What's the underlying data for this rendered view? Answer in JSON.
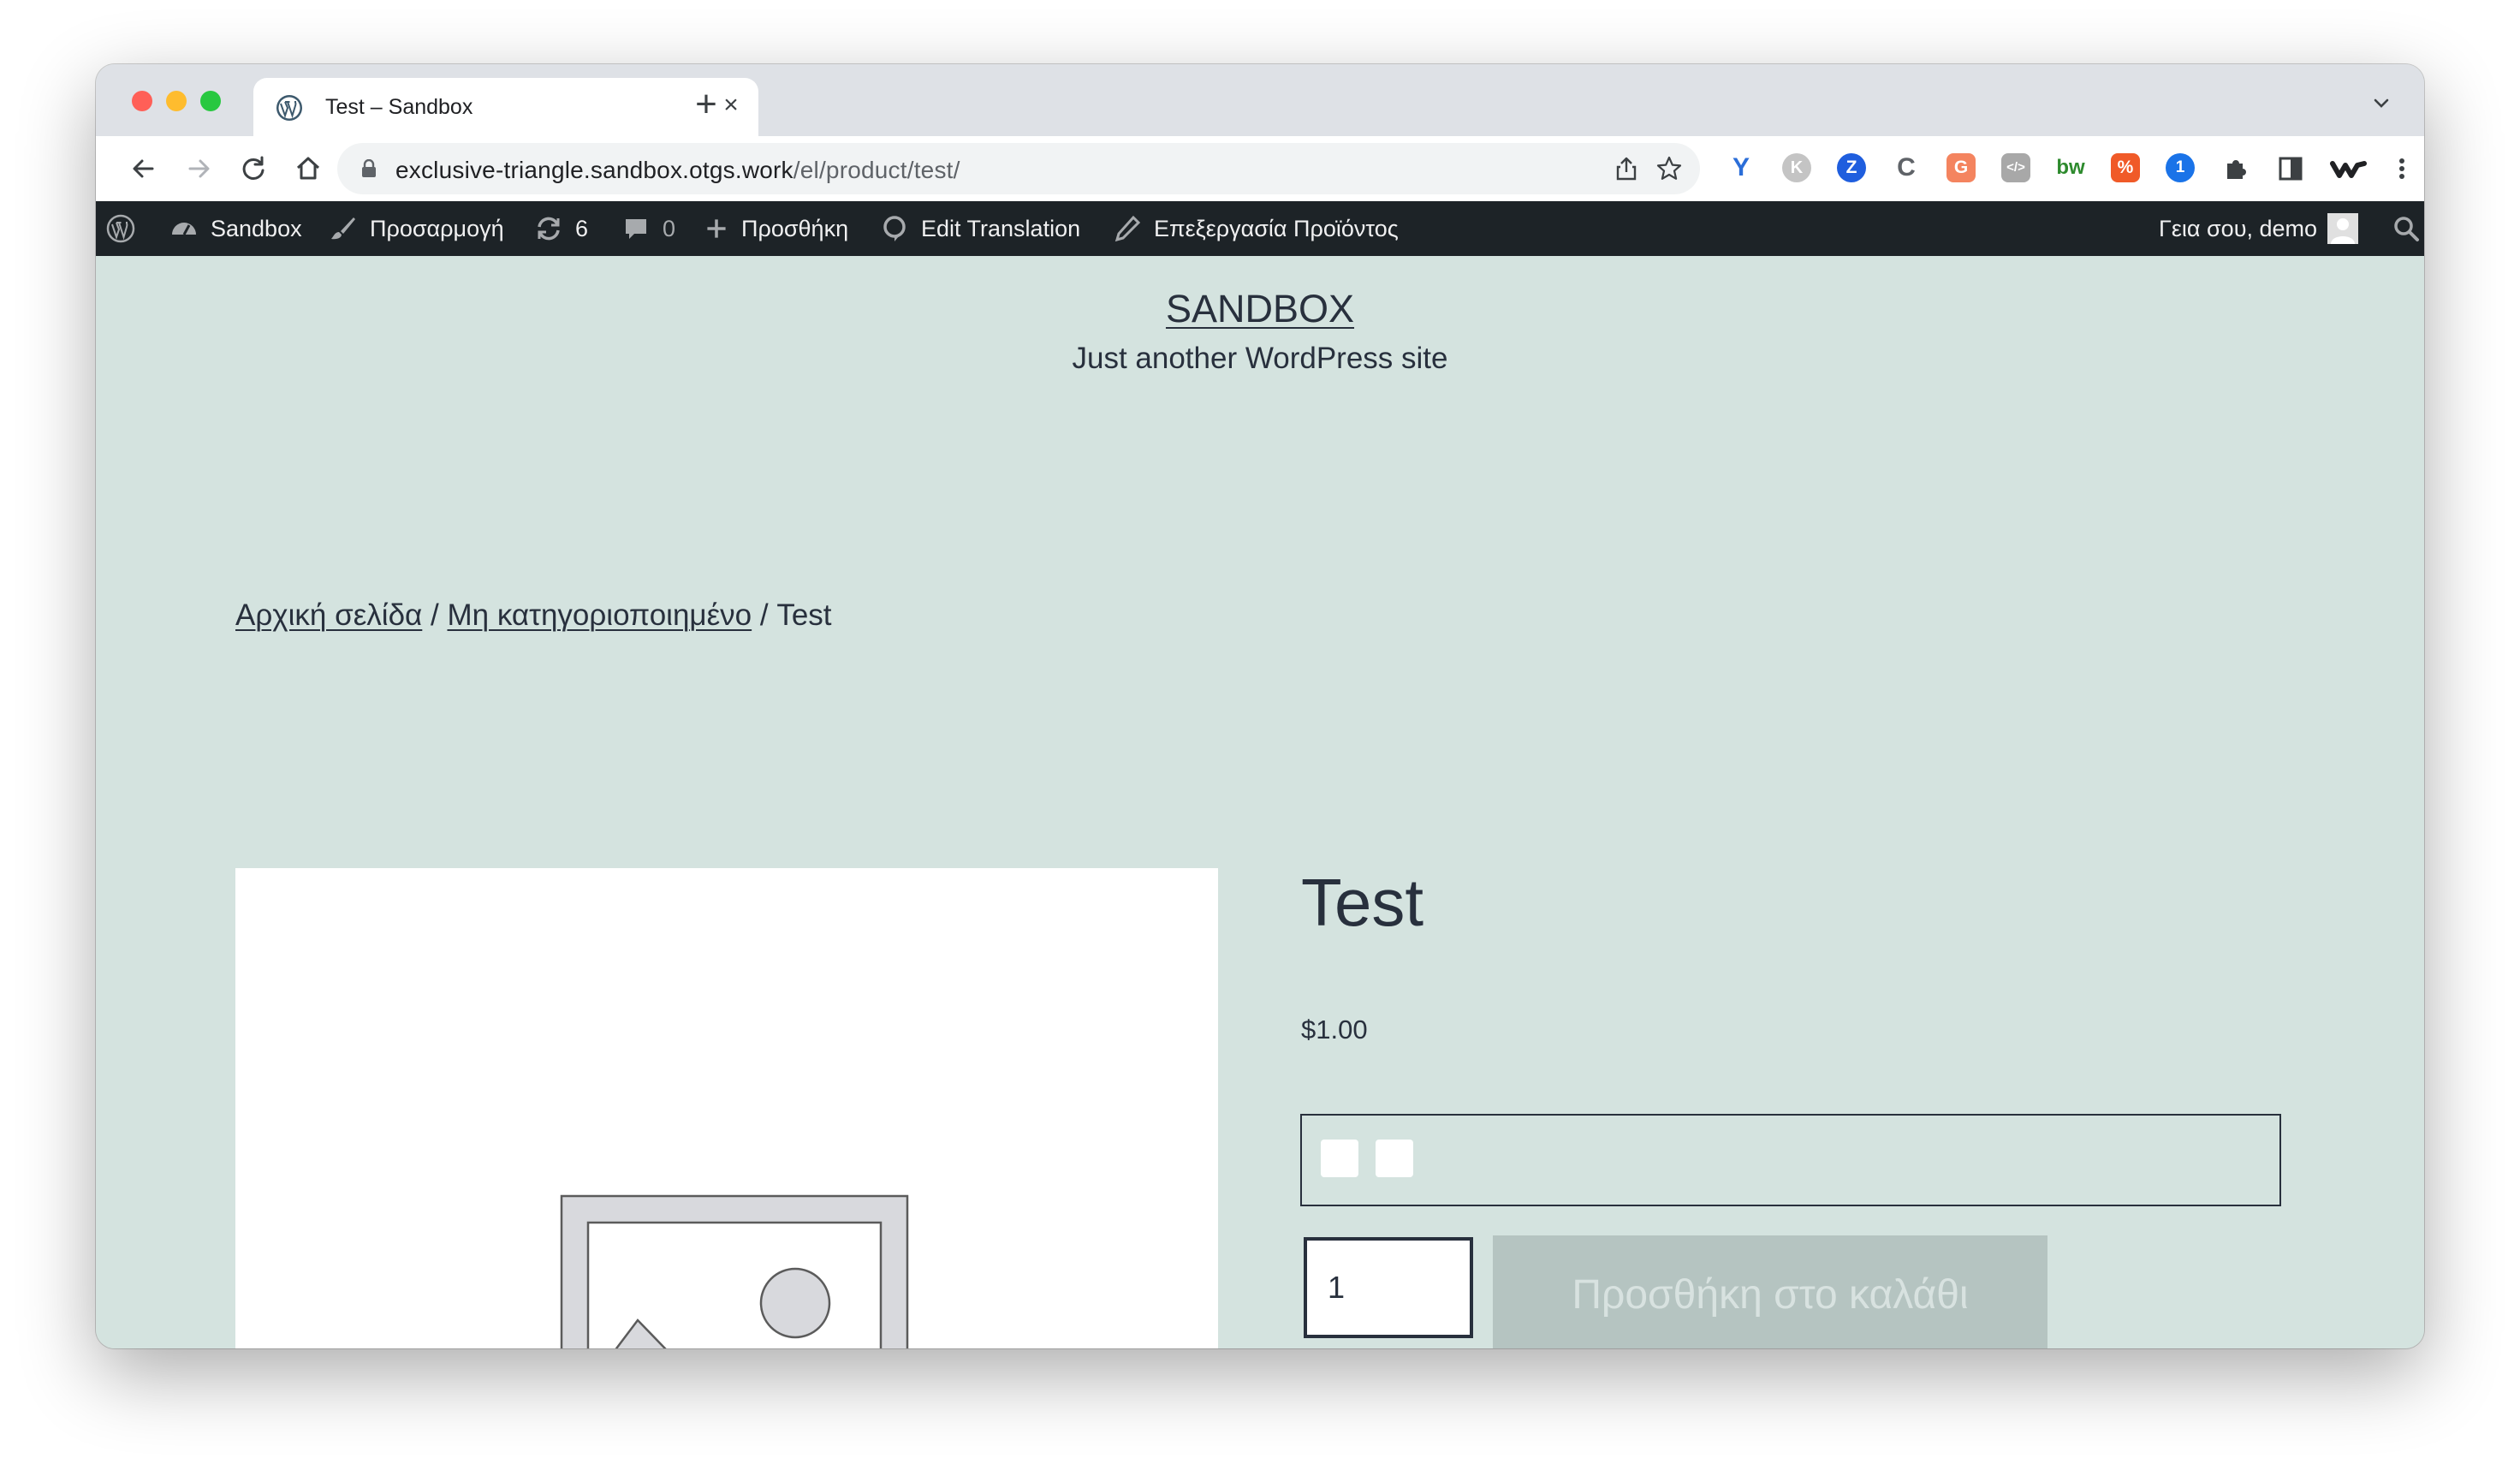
{
  "browser": {
    "tab": {
      "title": "Test – Sandbox",
      "close_glyph": "×",
      "favicon": "wordpress-icon"
    },
    "new_tab_glyph": "+",
    "url": {
      "host": "exclusive-triangle.sandbox.otgs.work",
      "path": "/el/product/test/"
    },
    "extensions": [
      {
        "name": "yoast-icon",
        "label": "Y",
        "color": "#2b6ed8"
      },
      {
        "name": "k-extension-icon",
        "label": "K",
        "color": "#b9b9b9"
      },
      {
        "name": "z-extension-icon",
        "label": "Z",
        "color": "#1f5ede"
      },
      {
        "name": "c-extension-icon",
        "label": "C",
        "color": "#5f6368"
      },
      {
        "name": "g-extension-icon",
        "label": "G",
        "color": "#f4845f"
      },
      {
        "name": "code-extension-icon",
        "label": "</>",
        "color": "#a0a0a0"
      },
      {
        "name": "bw-extension-icon",
        "label": "bw",
        "color": "#2d8a2d"
      },
      {
        "name": "percent-extension-icon",
        "label": "%",
        "color": "#f05a28"
      },
      {
        "name": "1password-icon",
        "label": "1",
        "color": "#1a73e8"
      }
    ]
  },
  "adminbar": {
    "site_name": "Sandbox",
    "customize": "Προσαρμογή",
    "updates_count": "6",
    "comments_count": "0",
    "new_label": "Προσθήκη",
    "edit_translation": "Edit Translation",
    "edit_product": "Επεξεργασία Προϊόντος",
    "greeting": "Γεια σου, demo"
  },
  "site": {
    "title": "SANDBOX",
    "description": "Just another WordPress site"
  },
  "breadcrumb": {
    "home": "Αρχική σελίδα",
    "separator": " / ",
    "category": "Μη κατηγοριοποιημένο",
    "current": "Test"
  },
  "product": {
    "title": "Test",
    "price": "$1.00",
    "quantity": "1",
    "add_to_cart_label": "Προσθήκη στο καλάθι"
  },
  "colors": {
    "page_background": "#d4e3df",
    "text": "#28303d",
    "adminbar": "#1d2327",
    "button_disabled": "#b5c4c1"
  }
}
